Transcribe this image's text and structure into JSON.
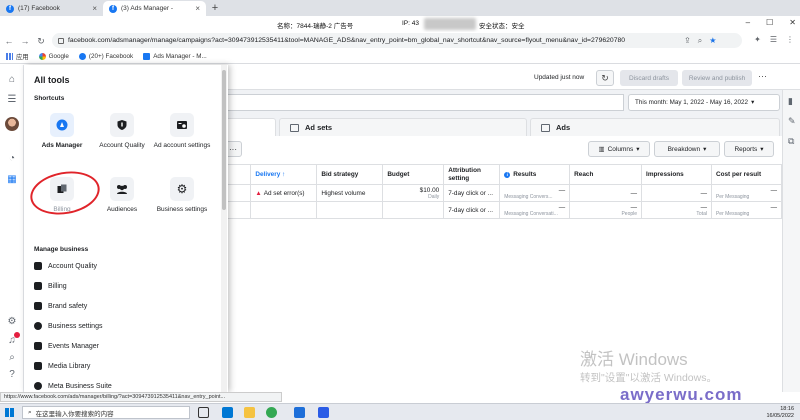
{
  "browser": {
    "tabs": [
      {
        "title": "(17) Facebook",
        "active": false
      },
      {
        "title": "(3) Ads Manager -",
        "active": true
      }
    ],
    "new_tab": "+",
    "info": {
      "account_label": "名称：7844-瑞静-2 广告号",
      "ip_label": "IP: 43",
      "status_label": "安全状态：安全"
    },
    "window_controls": [
      "–",
      "☐",
      "✕"
    ],
    "url": "facebook.com/adsmanager/manage/campaigns?act=309473912535411&tool=MANAGE_ADS&nav_entry_point=bm_global_nav_shortcut&nav_source=flyout_menu&nav_id=279620780",
    "bookmarks": [
      "应用",
      "Google",
      "(20+) Facebook",
      "Ads Manager - M..."
    ]
  },
  "ads": {
    "updated": "Updated just now",
    "discard": "Discard drafts",
    "review": "Review and publish",
    "more": "···",
    "date_range": "This month: May 1, 2022 - May 16, 2022",
    "tabs": [
      "Ad sets",
      "Ads"
    ],
    "toolbar": {
      "dots": "···",
      "columns": "Columns",
      "breakdown": "Breakdown",
      "reports": "Reports"
    },
    "table": {
      "headers": [
        "Delivery ↑",
        "Bid strategy",
        "Budget",
        "Attribution setting",
        "Results",
        "Reach",
        "Impressions",
        "Cost per result"
      ],
      "row1": {
        "delivery": "Ad set error(s)",
        "bid": "Highest volume",
        "budget": "$10.00",
        "budget_sub": "Daily",
        "attribution": "7-day click or ...",
        "results": "—",
        "results_sub": "Messaging Convers...",
        "reach": "—",
        "impressions": "—",
        "cost": "—",
        "cost_sub": "Per Messaging"
      },
      "row2": {
        "attribution": "7-day click or ...",
        "results": "—",
        "results_sub": "Messaging Conversati...",
        "reach": "—",
        "reach_sub": "People",
        "impressions": "—",
        "impressions_sub": "Total",
        "cost": "—",
        "cost_sub": "Per Messaging"
      }
    }
  },
  "flyout": {
    "title": "All tools",
    "shortcuts_label": "Shortcuts",
    "shortcuts": [
      {
        "label": "Ads Manager"
      },
      {
        "label": "Account Quality"
      },
      {
        "label": "Ad account settings"
      },
      {
        "label": "Billing"
      },
      {
        "label": "Audiences"
      },
      {
        "label": "Business settings"
      }
    ],
    "manage_label": "Manage business",
    "manage_items": [
      "Account Quality",
      "Billing",
      "Brand safety",
      "Business settings",
      "Events Manager",
      "Media Library",
      "Meta Business Suite"
    ]
  },
  "status_url": "https://www.facebook.com/ads/manager/billing/?act=309473912535411&nav_entry_point...",
  "watermark": {
    "line1": "激活 Windows",
    "line2": "转到\"设置\"以激活 Windows。",
    "logo": "awyerwu.com"
  },
  "taskbar": {
    "search": "在这里输入你要搜索的内容",
    "time": "18:16",
    "date": "16/05/2022"
  },
  "colors": {
    "accent": "#1877f2",
    "error": "#e41e3f",
    "annotation": "#e0242a"
  }
}
